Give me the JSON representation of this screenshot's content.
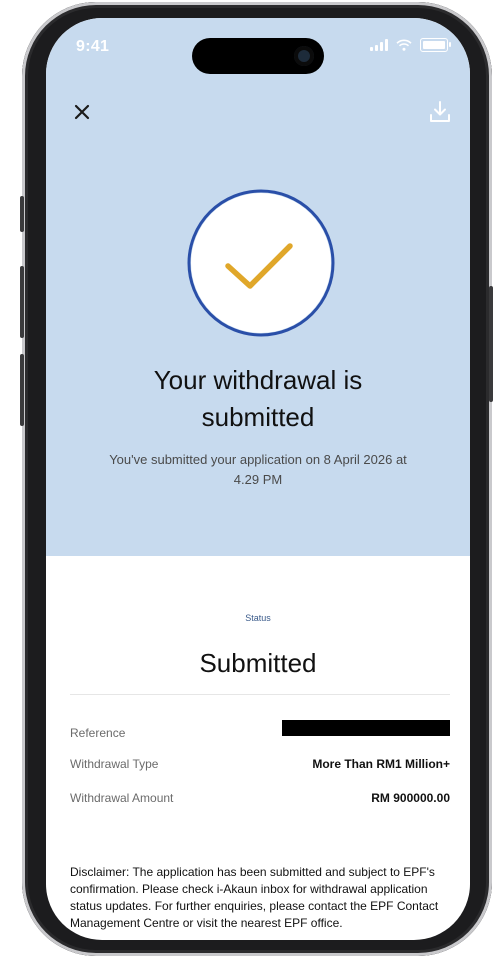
{
  "status_bar": {
    "time": "9:41"
  },
  "header": {
    "close_icon": "close-icon",
    "download_icon": "download-icon"
  },
  "hero": {
    "icon": "check-circle-icon",
    "title_line1": "Your withdrawal is",
    "title_line2": "submitted",
    "subtitle": "You've submitted your application on 8 April 2026 at 4.29 PM"
  },
  "status": {
    "label": "Status",
    "value": "Submitted"
  },
  "details": [
    {
      "key": "Reference",
      "value": "",
      "redacted": true
    },
    {
      "key": "Withdrawal Type",
      "value": "More Than RM1 Million+"
    },
    {
      "key": "Withdrawal Amount",
      "value": "RM 900000.00"
    }
  ],
  "disclaimer": "Disclaimer: The application has been submitted and subject to EPF's confirmation. Please check i-Akaun inbox for withdrawal application status updates. For further enquiries, please contact the EPF Contact Management Centre or visit the nearest EPF office.",
  "colors": {
    "hero_bg": "#c7daee",
    "ring": "#2a4fa8",
    "check": "#e0a72a"
  }
}
